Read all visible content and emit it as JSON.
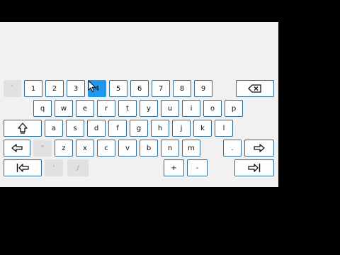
{
  "keyboard": {
    "row1": [
      "`",
      "1",
      "2",
      "3",
      "4",
      "5",
      "6",
      "7",
      "8",
      "9"
    ],
    "row2": [
      "q",
      "w",
      "e",
      "r",
      "t",
      "y",
      "u",
      "i",
      "o",
      "p"
    ],
    "row3": [
      "a",
      "s",
      "d",
      "f",
      "g",
      "h",
      "j",
      "k",
      "l"
    ],
    "row4": [
      "\"",
      "z",
      "x",
      "c",
      "v",
      "b",
      "n",
      "m",
      "."
    ],
    "row5": [
      "'",
      "/",
      "+",
      "-"
    ],
    "active_key": "4",
    "icons": {
      "backspace": "backspace-icon",
      "shift": "shift-icon",
      "left": "arrow-left-icon",
      "right": "arrow-right-icon",
      "home": "home-icon",
      "end": "end-icon"
    }
  },
  "colors": {
    "panel": "#f1f1f1",
    "key_border": "#2f6c98",
    "active_key": "#1e98ee",
    "inactive_key": "#e1e1e1"
  }
}
